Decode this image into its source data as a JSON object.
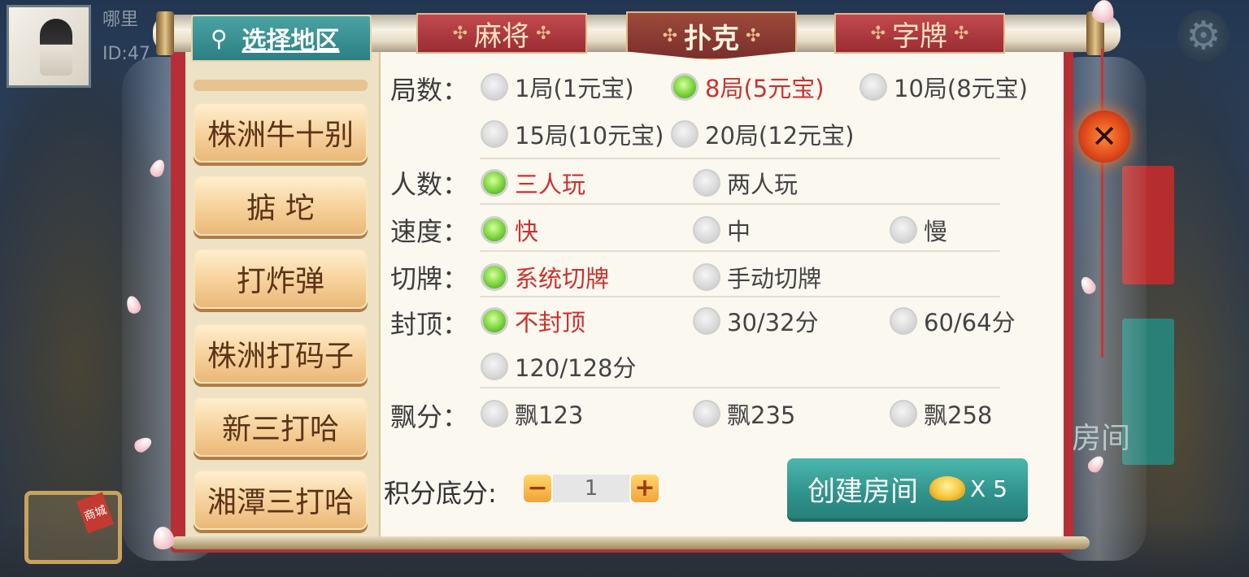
{
  "user": {
    "name": "哪里",
    "id": "ID:47"
  },
  "region_tab": {
    "label": "选择地区"
  },
  "tabs": [
    {
      "label": "麻将",
      "active": false
    },
    {
      "label": "扑克",
      "active": true
    },
    {
      "label": "字牌",
      "active": false
    }
  ],
  "tab_ornament": "✣",
  "games": [
    "株洲牛十别",
    "掂 坨",
    "打炸弹",
    "株洲打码子",
    "新三打哈",
    "湘潭三打哈"
  ],
  "rounds": {
    "label": "局数：",
    "options": [
      "1局(1元宝)",
      "8局(5元宝)",
      "10局(8元宝)",
      "15局(10元宝)",
      "20局(12元宝)"
    ],
    "selected": "8局(5元宝)"
  },
  "players": {
    "label": "人数：",
    "options": [
      "三人玩",
      "两人玩"
    ],
    "selected": "三人玩"
  },
  "speed": {
    "label": "速度：",
    "options": [
      "快",
      "中",
      "慢"
    ],
    "selected": "快"
  },
  "cut": {
    "label": "切牌：",
    "options": [
      "系统切牌",
      "手动切牌"
    ],
    "selected": "系统切牌"
  },
  "cap": {
    "label": "封顶：",
    "options": [
      "不封顶",
      "30/32分",
      "60/64分",
      "120/128分"
    ],
    "selected": "不封顶"
  },
  "float": {
    "label": "飘分：",
    "options": [
      "飘123",
      "飘235",
      "飘258"
    ],
    "selected": null
  },
  "score": {
    "label": "积分底分:",
    "value": "1",
    "minus": "−",
    "plus": "+"
  },
  "create": {
    "label": "创建房间",
    "cost": "X 5"
  },
  "close_glyph": "✕",
  "settings_glyph": "⚙",
  "region_pin": "⚲",
  "bg_room_text": "房间",
  "cart_tag": "商城",
  "colors": {
    "accent_red": "#c9322f",
    "frame_red": "#b72f36",
    "teal": "#2f928b"
  }
}
